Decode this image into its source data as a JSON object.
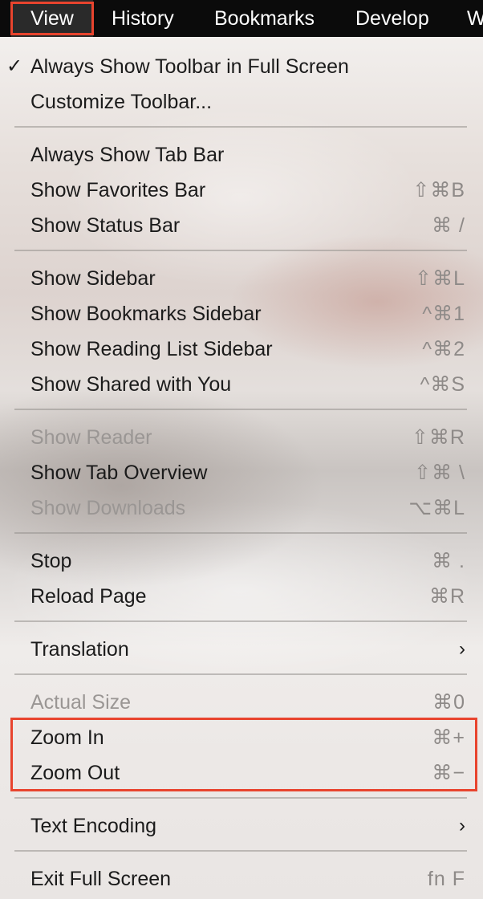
{
  "menubar": {
    "items": [
      {
        "label": "View"
      },
      {
        "label": "History"
      },
      {
        "label": "Bookmarks"
      },
      {
        "label": "Develop"
      },
      {
        "label": "W"
      }
    ]
  },
  "menu": {
    "items": [
      {
        "label": "Always Show Toolbar in Full Screen",
        "checked": true,
        "check": "✓"
      },
      {
        "label": "Customize Toolbar..."
      },
      {
        "label": "Always Show Tab Bar"
      },
      {
        "label": "Show Favorites Bar",
        "shortcut": "⇧⌘B"
      },
      {
        "label": "Show Status Bar",
        "shortcut": "⌘ /"
      },
      {
        "label": "Show Sidebar",
        "shortcut": "⇧⌘L"
      },
      {
        "label": "Show Bookmarks Sidebar",
        "shortcut": "^⌘1"
      },
      {
        "label": "Show Reading List Sidebar",
        "shortcut": "^⌘2"
      },
      {
        "label": "Show Shared with You",
        "shortcut": "^⌘S"
      },
      {
        "label": "Show Reader",
        "shortcut": "⇧⌘R",
        "disabled": true
      },
      {
        "label": "Show Tab Overview",
        "shortcut": "⇧⌘ \\"
      },
      {
        "label": "Show Downloads",
        "shortcut": "⌥⌘L",
        "disabled": true
      },
      {
        "label": "Stop",
        "shortcut": "⌘ ."
      },
      {
        "label": "Reload Page",
        "shortcut": "⌘R"
      },
      {
        "label": "Translation",
        "submenu": true,
        "arrow": "›"
      },
      {
        "label": "Actual Size",
        "shortcut": "⌘0",
        "disabled": true
      },
      {
        "label": "Zoom In",
        "shortcut": "⌘+"
      },
      {
        "label": "Zoom Out",
        "shortcut": "⌘−"
      },
      {
        "label": "Text Encoding",
        "submenu": true,
        "arrow": "›"
      },
      {
        "label": "Exit Full Screen",
        "shortcut": "fn F"
      }
    ]
  },
  "colors": {
    "highlight": "#e8442e",
    "menubar_bg": "#0b0b0b",
    "disabled_text": "#9a9694"
  }
}
